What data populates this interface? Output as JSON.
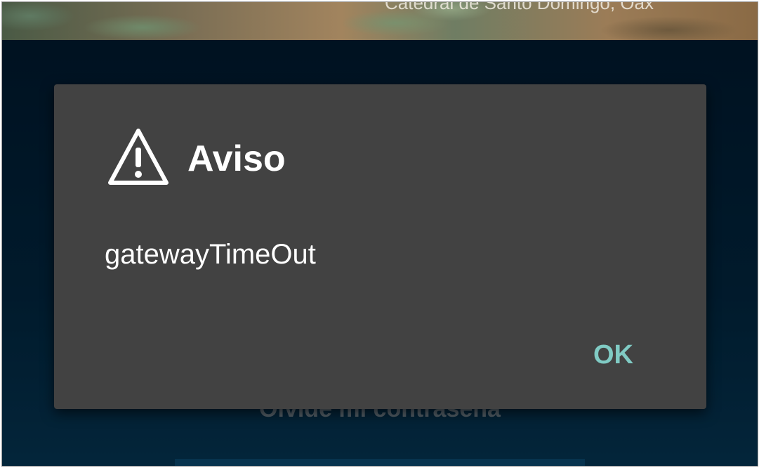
{
  "background": {
    "photo_caption": "Catedral de Santo Domingo, Oax",
    "forgot_password_link": "Olvidé mi contraseña"
  },
  "dialog": {
    "icon": "warning-icon",
    "title": "Aviso",
    "message": "gatewayTimeOut",
    "ok_label": "OK",
    "accent_color": "#80cbc4",
    "background_color": "#424242"
  }
}
